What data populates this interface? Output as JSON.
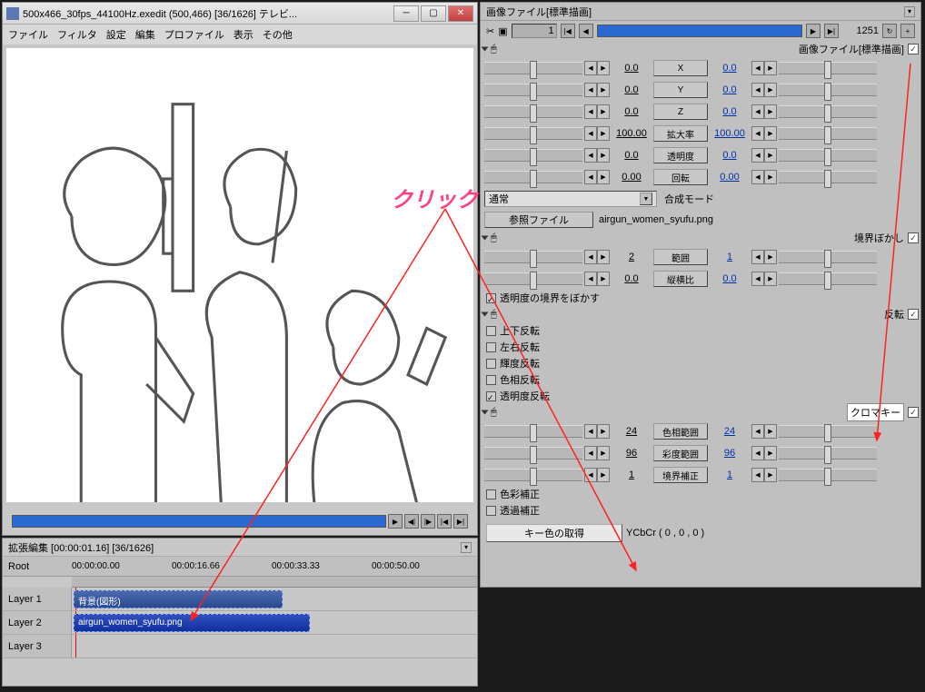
{
  "main": {
    "title": "500x466_30fps_44100Hz.exedit (500,466) [36/1626] テレビ...",
    "menu": [
      "ファイル",
      "フィルタ",
      "設定",
      "編集",
      "プロファイル",
      "表示",
      "その他"
    ]
  },
  "timeline": {
    "title": "拡張編集 [00:00:01.16] [36/1626]",
    "root": "Root",
    "times": [
      "00:00:00.00",
      "00:00:16.66",
      "00:00:33.33",
      "00:00:50.00"
    ],
    "layers": [
      "Layer 1",
      "Layer 2",
      "Layer 3"
    ],
    "clip1": "背景(図形)",
    "clip2": "airgun_women_syufu.png"
  },
  "panel": {
    "title": "画像ファイル[標準描画]",
    "frame_current": "1",
    "frame_total": "1251",
    "section1_label": "画像ファイル[標準描画]",
    "params1": [
      {
        "v": "0.0",
        "label": "X",
        "v2": "0.0"
      },
      {
        "v": "0.0",
        "label": "Y",
        "v2": "0.0"
      },
      {
        "v": "0.0",
        "label": "Z",
        "v2": "0.0"
      },
      {
        "v": "100.00",
        "label": "拡大率",
        "v2": "100.00"
      },
      {
        "v": "0.0",
        "label": "透明度",
        "v2": "0.0"
      },
      {
        "v": "0.00",
        "label": "回転",
        "v2": "0.00"
      }
    ],
    "blend_label": "合成モード",
    "blend_value": "通常",
    "ref_btn": "参照ファイル",
    "ref_file": "airgun_women_syufu.png",
    "section2_label": "境界ぼかし",
    "params2": [
      {
        "v": "2",
        "label": "範囲",
        "v2": "1"
      },
      {
        "v": "0.0",
        "label": "縦横比",
        "v2": "0.0"
      }
    ],
    "blur_alpha": "透明度の境界をぼかす",
    "section3_label": "反転",
    "invert_opts": [
      "上下反転",
      "左右反転",
      "輝度反転",
      "色相反転",
      "透明度反転"
    ],
    "section4_label": "クロマキー",
    "params4": [
      {
        "v": "24",
        "label": "色相範囲",
        "v2": "24"
      },
      {
        "v": "96",
        "label": "彩度範囲",
        "v2": "96"
      },
      {
        "v": "1",
        "label": "境界補正",
        "v2": "1"
      }
    ],
    "chroma_opts": [
      "色彩補正",
      "透過補正"
    ],
    "get_key": "キー色の取得",
    "ycbcr": "YCbCr ( 0 , 0 , 0 )"
  },
  "anno": {
    "click": "クリック"
  }
}
